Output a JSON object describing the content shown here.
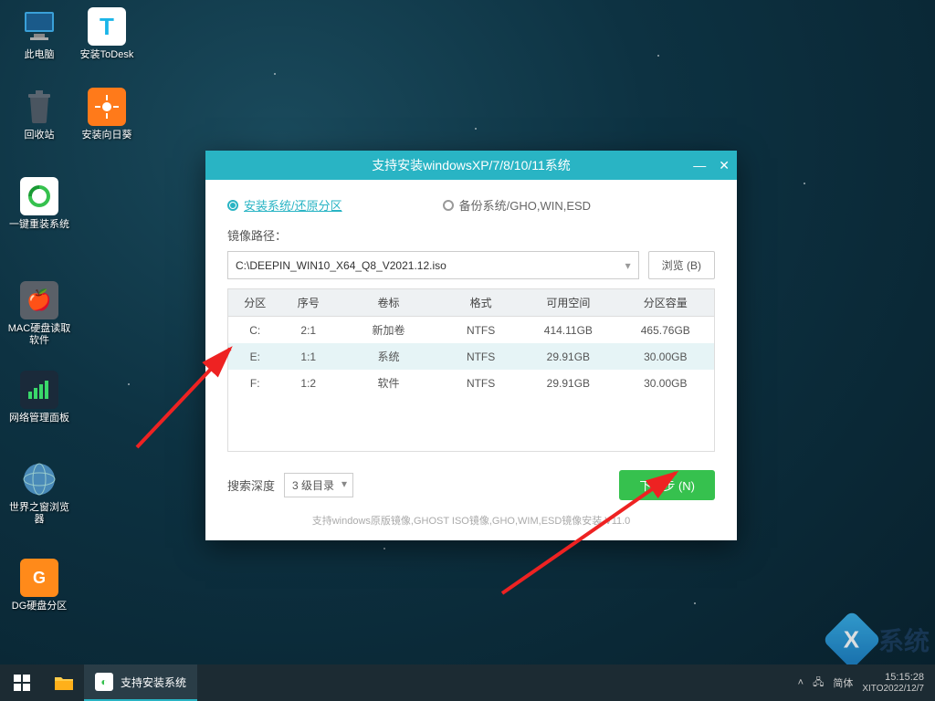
{
  "desktop": {
    "icons": [
      {
        "label": "此电脑"
      },
      {
        "label": "安装ToDesk"
      },
      {
        "label": "回收站"
      },
      {
        "label": "安装向日葵"
      },
      {
        "label": "一键重装系统"
      },
      {
        "label": "MAC硬盘读取软件"
      },
      {
        "label": "网络管理面板"
      },
      {
        "label": "世界之窗浏览器"
      },
      {
        "label": "DG硬盘分区"
      }
    ]
  },
  "dialog": {
    "title": "支持安装windowsXP/7/8/10/11系统",
    "radio_install": "安装系统/还原分区",
    "radio_backup": "备份系统/GHO,WIN,ESD",
    "path_label": "镜像路径：",
    "path_value": "C:\\DEEPIN_WIN10_X64_Q8_V2021.12.iso",
    "browse": "浏览 (B)",
    "cols": {
      "c0": "分区",
      "c1": "序号",
      "c2": "卷标",
      "c3": "格式",
      "c4": "可用空间",
      "c5": "分区容量"
    },
    "rows": [
      {
        "p": "C:",
        "n": "2:1",
        "v": "新加卷",
        "f": "NTFS",
        "free": "414.11GB",
        "cap": "465.76GB"
      },
      {
        "p": "E:",
        "n": "1:1",
        "v": "系统",
        "f": "NTFS",
        "free": "29.91GB",
        "cap": "30.00GB"
      },
      {
        "p": "F:",
        "n": "1:2",
        "v": "软件",
        "f": "NTFS",
        "free": "29.91GB",
        "cap": "30.00GB"
      }
    ],
    "depth_label": "搜索深度",
    "depth_value": "3 级目录",
    "next": "下一步 (N)",
    "footer": "支持windows原版镜像,GHOST ISO镜像,GHO,WIM,ESD镜像安装 V11.0"
  },
  "taskbar": {
    "active_task": "支持安装系统",
    "ime": "简体",
    "time": "15:15:28",
    "date": "XITO2022/12/7"
  },
  "watermark": "系统"
}
